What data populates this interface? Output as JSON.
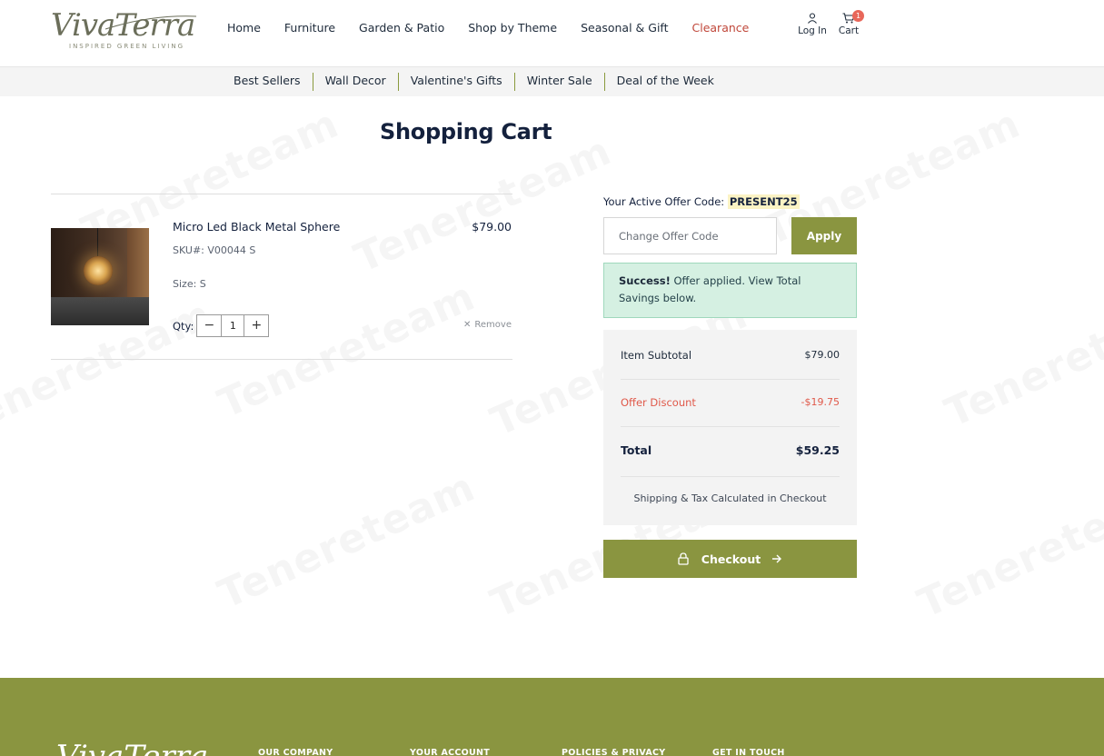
{
  "brand": {
    "logo_text": "VivaTerra",
    "tagline": "INSPIRED GREEN LIVING"
  },
  "main_nav": [
    {
      "label": "Home"
    },
    {
      "label": "Furniture"
    },
    {
      "label": "Garden & Patio"
    },
    {
      "label": "Shop by Theme"
    },
    {
      "label": "Seasonal & Gift"
    },
    {
      "label": "Clearance"
    }
  ],
  "header_actions": {
    "login_label": "Log In",
    "cart_label": "Cart",
    "cart_count": "1"
  },
  "sub_nav": [
    {
      "label": "Best Sellers"
    },
    {
      "label": "Wall Decor"
    },
    {
      "label": "Valentine's Gifts"
    },
    {
      "label": "Winter Sale"
    },
    {
      "label": "Deal of the Week"
    }
  ],
  "page_title": "Shopping Cart",
  "cart_item": {
    "name": "Micro Led Black Metal Sphere",
    "sku": "SKU#: V00044 S",
    "size": "Size: S",
    "price": "$79.00",
    "qty_label": "Qty:",
    "qty": "1",
    "decrement": "−",
    "increment": "+",
    "remove_label": "Remove"
  },
  "offer": {
    "active_label": "Your Active Offer Code:",
    "active_code": "PRESENT25",
    "input_placeholder": "Change Offer Code",
    "apply_label": "Apply",
    "success_strong": "Success!",
    "success_text": " Offer applied. View Total Savings below."
  },
  "summary": {
    "subtotal_label": "Item Subtotal",
    "subtotal_value": "$79.00",
    "discount_label": "Offer Discount",
    "discount_value": "-$19.75",
    "total_label": "Total",
    "total_value": "$59.25",
    "note": "Shipping & Tax Calculated in Checkout"
  },
  "checkout_label": "Checkout",
  "footer": {
    "logo_text": "VivaTerra",
    "columns": [
      "OUR COMPANY",
      "YOUR ACCOUNT",
      "POLICIES & PRIVACY",
      "GET IN TOUCH"
    ]
  },
  "watermark_text": "Tenereteam",
  "colors": {
    "accent": "#8a9540",
    "clearance": "#c0473a",
    "discount": "#e0594a",
    "success_bg": "#d5f0e2",
    "badge": "#e8675a"
  }
}
